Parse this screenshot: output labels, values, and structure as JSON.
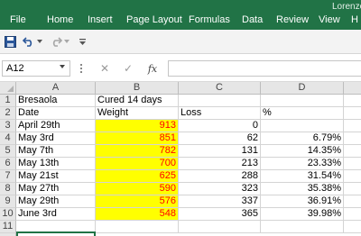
{
  "ribbon": {
    "tabs": [
      "File",
      "Home",
      "Insert",
      "Page Layout",
      "Formulas",
      "Data",
      "Review",
      "View",
      "H"
    ],
    "user": "Lorenzo"
  },
  "quick_access": {
    "icons": [
      "save-icon",
      "undo-icon",
      "undo-dropdown-icon",
      "redo-icon",
      "redo-dropdown-icon",
      "customize-qat-icon"
    ]
  },
  "formula_bar": {
    "name_box": "A12",
    "fx_label": "fx",
    "formula": ""
  },
  "sheet": {
    "columns": [
      "A",
      "B",
      "C",
      "D"
    ],
    "rows": [
      {
        "num": "1",
        "A": "Bresaola",
        "B": "Cured 14 days",
        "C": "",
        "D": ""
      },
      {
        "num": "2",
        "A": "Date",
        "B": "Weight",
        "C": "Loss",
        "D": "%"
      },
      {
        "num": "3",
        "A": "April 29th",
        "B": "913",
        "C": "0",
        "D": ""
      },
      {
        "num": "4",
        "A": "May 3rd",
        "B": "851",
        "C": "62",
        "D": "6.79%"
      },
      {
        "num": "5",
        "A": "May 7th",
        "B": "782",
        "C": "131",
        "D": "14.35%"
      },
      {
        "num": "6",
        "A": "May 13th",
        "B": "700",
        "C": "213",
        "D": "23.33%"
      },
      {
        "num": "7",
        "A": "May 21st",
        "B": "625",
        "C": "288",
        "D": "31.54%"
      },
      {
        "num": "8",
        "A": "May 27th",
        "B": "590",
        "C": "323",
        "D": "35.38%"
      },
      {
        "num": "9",
        "A": "May 29th",
        "B": "576",
        "C": "337",
        "D": "36.91%"
      },
      {
        "num": "10",
        "A": "June 3rd",
        "B": "548",
        "C": "365",
        "D": "39.98%"
      },
      {
        "num": "11",
        "A": "",
        "B": "",
        "C": "",
        "D": ""
      }
    ],
    "highlight": {
      "fill": "#ffff00",
      "text": "#ff0000"
    }
  },
  "colors": {
    "ribbon": "#217346",
    "header_fill": "#e6e6e6",
    "selection": "#217346"
  }
}
